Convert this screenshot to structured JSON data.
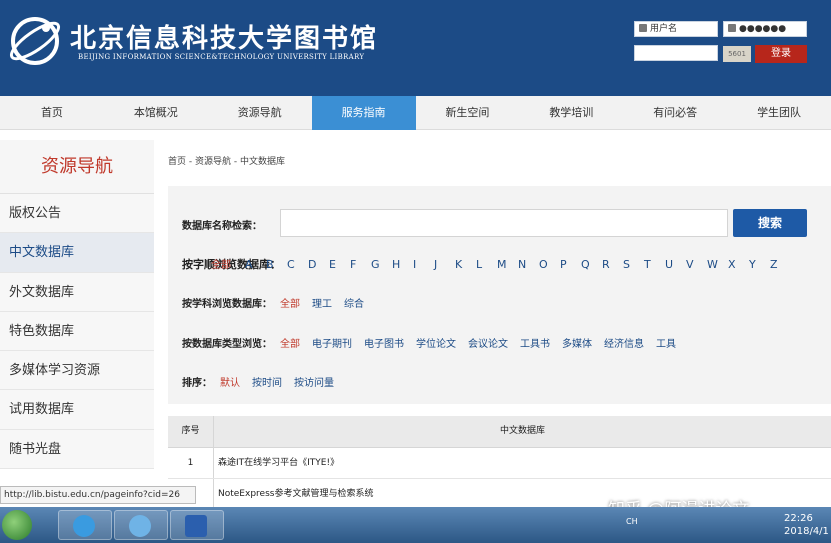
{
  "header": {
    "logo_cn": "北京信息科技大学图书馆",
    "logo_en": "BEIJING INFORMATION SCIENCE&TECHNOLOGY UNIVERSITY LIBRARY",
    "username_placeholder": "用户名",
    "password_value": "●●●●●●",
    "captcha_text": "5601",
    "login_label": "登录"
  },
  "nav": [
    "首页",
    "本馆概况",
    "资源导航",
    "服务指南",
    "新生空间",
    "教学培训",
    "有问必答",
    "学生团队"
  ],
  "nav_active_index": 3,
  "sidebar": {
    "title": "资源导航",
    "items": [
      "版权公告",
      "中文数据库",
      "外文数据库",
      "特色数据库",
      "多媒体学习资源",
      "试用数据库",
      "随书光盘"
    ],
    "active_index": 1
  },
  "breadcrumb": "首页 - 资源导航 - 中文数据库",
  "search": {
    "label": "数据库名称检索：",
    "button": "搜索"
  },
  "alpha": {
    "label": "按字顺浏览数据库：",
    "all": "全部",
    "letters": [
      "A",
      "B",
      "C",
      "D",
      "E",
      "F",
      "G",
      "H",
      "I",
      "J",
      "K",
      "L",
      "M",
      "N",
      "O",
      "P",
      "Q",
      "R",
      "S",
      "T",
      "U",
      "V",
      "W",
      "X",
      "Y",
      "Z"
    ]
  },
  "subject": {
    "label": "按学科浏览数据库：",
    "options": [
      "全部",
      "理工",
      "综合"
    ]
  },
  "dbtype": {
    "label": "按数据库类型浏览：",
    "options": [
      "全部",
      "电子期刊",
      "电子图书",
      "学位论文",
      "会议论文",
      "工具书",
      "多媒体",
      "经济信息",
      "工具"
    ]
  },
  "sort": {
    "label": "排序：",
    "options": [
      "默认",
      "按时间",
      "按访问量"
    ]
  },
  "table": {
    "headers": [
      "序号",
      "中文数据库"
    ],
    "rows": [
      {
        "no": "1",
        "name": "森途IT在线学习平台《ITYE!》"
      },
      {
        "no": "",
        "name": "NoteExpress参考文献管理与检索系统"
      }
    ]
  },
  "status_url": "http://lib.bistu.edu.cn/pageinfo?cid=26",
  "watermark": "知乎 @阿漫讲论文",
  "taskbar": {
    "tray_text": "CH",
    "time": "22:26",
    "date": "2018/4/1"
  }
}
